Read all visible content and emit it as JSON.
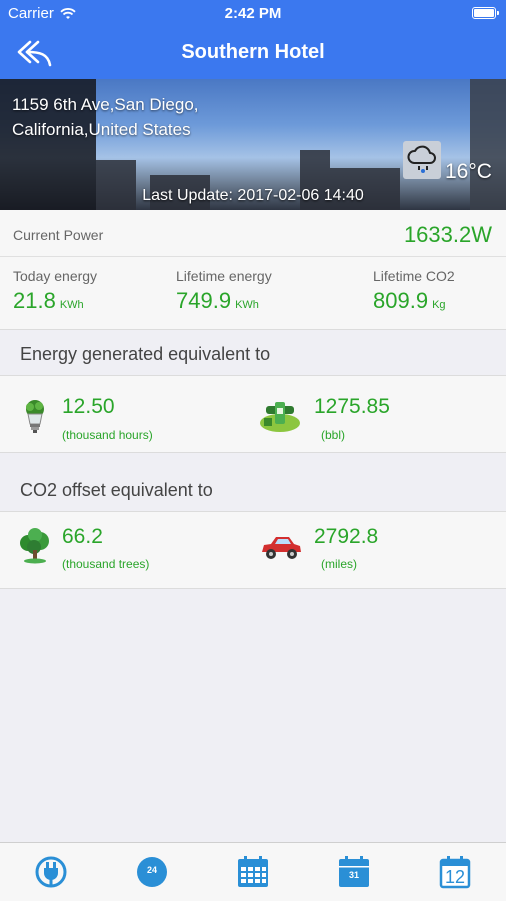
{
  "status_bar": {
    "carrier": "Carrier",
    "time": "2:42 PM"
  },
  "nav": {
    "title": "Southern Hotel",
    "back_icon": "back-arrow-icon"
  },
  "hero": {
    "address_line1": "1159 6th Ave,San Diego,",
    "address_line2": "California,United States",
    "temperature": "16°C",
    "weather_icon": "cloud-rain-icon",
    "last_update": "Last Update: 2017-02-06 14:40"
  },
  "power": {
    "label": "Current Power",
    "value": "1633.2W"
  },
  "stats": [
    {
      "label": "Today energy",
      "value": "21.8",
      "unit": "KWh"
    },
    {
      "label": "Lifetime energy",
      "value": "749.9",
      "unit": "KWh"
    },
    {
      "label": "Lifetime CO2",
      "value": "809.9",
      "unit": "Kg"
    }
  ],
  "energy_section": {
    "title": "Energy generated equivalent to",
    "items": [
      {
        "icon": "lightbulb-icon",
        "value": "12.50",
        "sub": "(thousand hours)"
      },
      {
        "icon": "oil-pump-icon",
        "value": "1275.85",
        "sub": "(bbl)"
      }
    ]
  },
  "co2_section": {
    "title": "CO2 offset equivalent to",
    "items": [
      {
        "icon": "tree-icon",
        "value": "66.2",
        "sub": "(thousand trees)"
      },
      {
        "icon": "car-icon",
        "value": "2792.8",
        "sub": "(miles)"
      }
    ]
  },
  "tabbar": {
    "tabs": [
      {
        "icon": "plug-icon"
      },
      {
        "icon": "day-24-icon",
        "label": "24"
      },
      {
        "icon": "calendar-month-icon"
      },
      {
        "icon": "calendar-31-icon",
        "label": "31"
      },
      {
        "icon": "calendar-12-icon",
        "label": "12"
      }
    ]
  },
  "colors": {
    "accent": "#3b78ef",
    "value_green": "#2aa52a",
    "tab_blue": "#2a8fd6"
  }
}
